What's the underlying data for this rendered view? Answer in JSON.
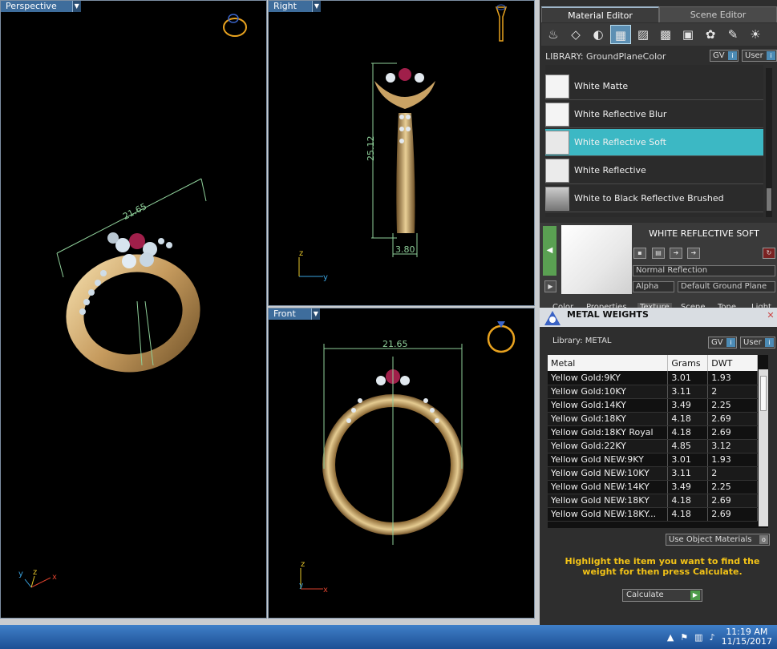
{
  "viewports": {
    "perspective": {
      "label": "Perspective",
      "dim": "21.65"
    },
    "right": {
      "label": "Right",
      "dim_height": "25.12",
      "dim_width": "3.80"
    },
    "front": {
      "label": "Front",
      "dim": "21.65"
    }
  },
  "axes": {
    "x": "x",
    "y": "y",
    "z": "z"
  },
  "panel": {
    "tabs": [
      "Material Editor",
      "Scene Editor"
    ],
    "library_label": "LIBRARY: GroundPlaneColor",
    "gv_label": "GV",
    "user_label": "User",
    "materials": [
      {
        "name": "White Matte",
        "selected": false
      },
      {
        "name": "White Reflective Blur",
        "selected": false
      },
      {
        "name": "White Reflective Soft",
        "selected": true
      },
      {
        "name": "White Reflective",
        "selected": false
      },
      {
        "name": "White to Black Reflective Brushed",
        "selected": false
      }
    ],
    "selected_material_title": "WHITE REFLECTIVE SOFT",
    "reflection_type": "Normal Reflection",
    "alpha_label": "Alpha",
    "ground_plane_combo": "Default Ground Plane",
    "sub_tabs": [
      "Color",
      "Properties",
      "Texture",
      "Scene",
      "Tone",
      "Light"
    ]
  },
  "metal_weights": {
    "title": "METAL WEIGHTS",
    "library_label": "Library: METAL",
    "gv_label": "GV",
    "user_label": "User",
    "headers": [
      "Metal",
      "Grams",
      "DWT"
    ],
    "rows": [
      [
        "Yellow Gold:9KY",
        "3.01",
        "1.93"
      ],
      [
        "Yellow Gold:10KY",
        "3.11",
        "2"
      ],
      [
        "Yellow Gold:14KY",
        "3.49",
        "2.25"
      ],
      [
        "Yellow Gold:18KY",
        "4.18",
        "2.69"
      ],
      [
        "Yellow Gold:18KY Royal",
        "4.18",
        "2.69"
      ],
      [
        "Yellow Gold:22KY",
        "4.85",
        "3.12"
      ],
      [
        "Yellow Gold NEW:9KY",
        "3.01",
        "1.93"
      ],
      [
        "Yellow Gold NEW:10KY",
        "3.11",
        "2"
      ],
      [
        "Yellow Gold NEW:14KY",
        "3.49",
        "2.25"
      ],
      [
        "Yellow Gold NEW:18KY",
        "4.18",
        "2.69"
      ],
      [
        "Yellow Gold NEW:18KY...",
        "4.18",
        "2.69"
      ]
    ],
    "use_object_materials": "Use Object Materials",
    "hint": "Highlight the item you want to find the weight for then press Calculate.",
    "calculate_label": "Calculate"
  },
  "taskbar": {
    "time": "11:19 AM",
    "date": "11/15/2017"
  }
}
